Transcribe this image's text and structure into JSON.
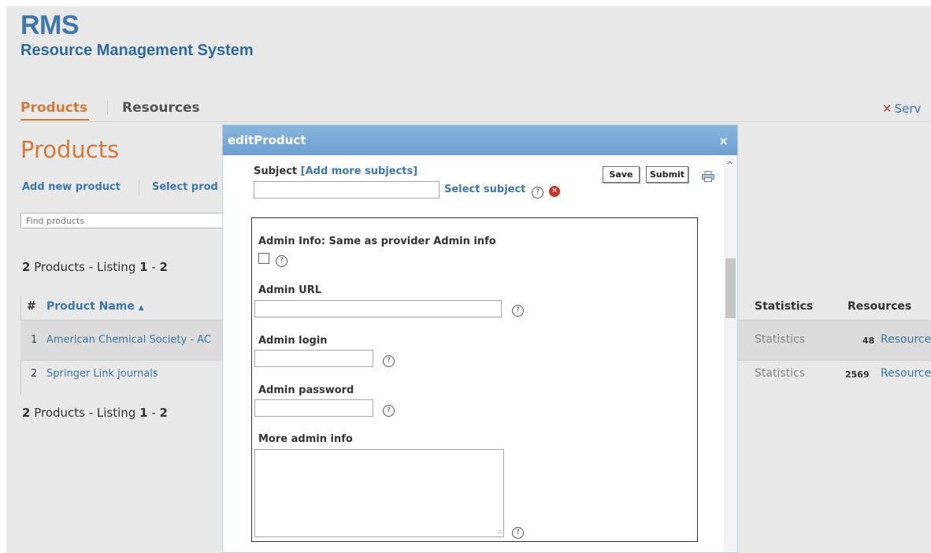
{
  "header": {
    "logo": "RMS",
    "subtitle": "Resource Management System"
  },
  "nav": {
    "tabs": [
      {
        "label": "Products",
        "active": true
      },
      {
        "label": "Resources",
        "active": false
      }
    ],
    "right_link": "Serv"
  },
  "main": {
    "title": "Products",
    "actions": [
      "Add new product",
      "Select prod"
    ],
    "find_placeholder": "Find products",
    "listing_count": "2",
    "listing_text": " Products - Listing ",
    "listing_from": "1",
    "listing_dash": " - ",
    "listing_to": "2"
  },
  "table": {
    "columns": {
      "num": "#",
      "name": "Product Name",
      "sort_indicator": "▲",
      "statistics": "Statistics",
      "resources": "Resources"
    },
    "rows": [
      {
        "num": "1",
        "name": "American Chemical Society - AC",
        "statistics": "Statistics",
        "count": "48",
        "resources": "Resource"
      },
      {
        "num": "2",
        "name": "Springer Link journals",
        "statistics": "Statistics",
        "count": "2569",
        "resources": "Resource"
      }
    ]
  },
  "modal": {
    "title": "editProduct",
    "close": "×",
    "subject_label": "Subject",
    "add_subjects": "[Add more subjects]",
    "select_subject": "Select subject",
    "save": "Save",
    "submit": "Submit",
    "admin_info_label": "Admin Info: Same as provider Admin info",
    "admin_url_label": "Admin URL",
    "admin_login_label": "Admin login",
    "admin_password_label": "Admin password",
    "more_admin_label": "More admin info",
    "help_glyph": "?",
    "error_glyph": "✕",
    "scroll_up_glyph": "^",
    "grip_glyph": ".::"
  },
  "colors": {
    "accent_orange": "#d07a3c",
    "link_blue": "#3f78a6",
    "modal_header": "#7aa9d6"
  },
  "icons": [
    "help-icon",
    "error-icon",
    "print-icon",
    "close-icon",
    "x-tool-icon",
    "sort-asc-icon"
  ]
}
